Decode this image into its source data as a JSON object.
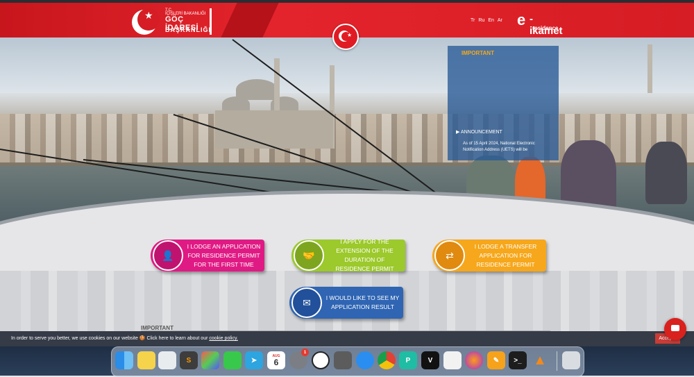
{
  "header": {
    "logo_line1": "T.C.",
    "logo_line2": "İÇİŞLERİ BAKANLIĞI",
    "logo_line3": "GÖÇ İDARESİ",
    "logo_line4": "BAŞKANLIĞI",
    "languages": [
      "Tr",
      "Ru",
      "En",
      "Ar"
    ],
    "ikamet_prefix": "e",
    "ikamet_word": "-ikamet",
    "ikamet_sub": "residence"
  },
  "notice": {
    "heading": "IMPORTANT",
    "announcement": "▶ ANNOUNCEMENT",
    "body": "As of 15 April 2024, National Electronic Notification Address (UETS) will be"
  },
  "actions": [
    {
      "label": "I LODGE AN APPLICATION FOR RESIDENCE PERMIT FOR THE FIRST TIME",
      "icon": "person-icon",
      "color": "#e01a84"
    },
    {
      "label": "I APPLY FOR THE EXTENSION OF THE DURATION OF RESIDENCE PERMIT",
      "icon": "handshake-icon",
      "color": "#9cc92b"
    },
    {
      "label": "I LODGE A TRANSFER APPLICATION FOR RESIDENCE PERMIT",
      "icon": "transfer-icon",
      "color": "#f6a71b"
    },
    {
      "label": "I WOULD LIKE TO SEE MY APPLICATION RESULT",
      "icon": "result-icon",
      "color": "#2f65b3"
    }
  ],
  "important_section": "IMPORTANT",
  "cookie": {
    "text": "In order to serve you better, we use cookies on our website 🍪 Click here to learn about our",
    "link": "cookie policy.",
    "accept": "Accep..."
  },
  "dock": {
    "calendar_month": "AUG",
    "calendar_day": "6",
    "badge": "1",
    "icons": [
      "finder-icon",
      "notes-icon",
      "preview-icon",
      "sublime-icon",
      "launchpad-icon",
      "messages-icon",
      "telegram-icon",
      "calendar-icon",
      "settings-icon",
      "clock-icon",
      "calculator-icon",
      "safari-icon",
      "chrome-icon",
      "pycharm-icon",
      "v2-icon",
      "textedit-icon",
      "firefox-icon",
      "pencil-icon",
      "terminal-icon",
      "vlc-icon",
      "trash-icon"
    ]
  }
}
